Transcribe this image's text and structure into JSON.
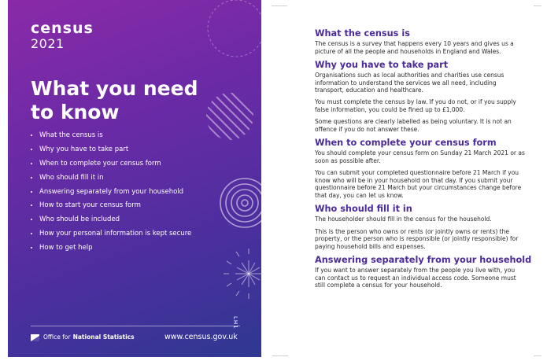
{
  "cover": {
    "brand": "census",
    "year": "2021",
    "title_line1": "What you need",
    "title_line2": "to know",
    "bullets": [
      "What the census is",
      "Why you have to take part",
      "When to complete your census form",
      "Who should fill it in",
      "Answering separately from your household",
      "How to start your census form",
      "Who should be included",
      "How your personal information is kept secure",
      "How to get help"
    ],
    "ons_prefix": "Office for",
    "ons_bold": "National Statistics",
    "url": "www.census.gov.uk",
    "code": "LH1",
    "colors": {
      "gradient_top": "#8a2aa8",
      "gradient_bottom": "#2f3892",
      "text": "#ffffff"
    }
  },
  "sections": {
    "s1": {
      "heading": "What the census is",
      "p1": "The census is a survey that happens every 10 years and gives us a picture of all the people and households in England and Wales."
    },
    "s2": {
      "heading": "Why you have to take part",
      "p1": "Organisations such as local authorities and charities use census information to understand the services we all need, including transport, education and healthcare.",
      "p2": "You must complete the census by law. If you do not, or if you supply false information, you could be fined up to £1,000.",
      "p3": "Some questions are clearly labelled as being voluntary. It is not an offence if you do not answer these."
    },
    "s3": {
      "heading": "When to complete your census form",
      "p1": "You should complete your census form on Sunday 21 March 2021 or as soon as possible after.",
      "p2": "You can submit your completed questionnaire before 21 March if you know who will be in your household on that day. If you submit your questionnaire before 21 March but your circumstances change before that day, you can let us know."
    },
    "s4": {
      "heading": "Who should fill it in",
      "p1": "The householder should fill in the census for the household.",
      "p2": "This is the person who owns or rents (or jointly owns or rents) the property, or the person who is responsible (or jointly responsible) for paying household bills and expenses."
    },
    "s5": {
      "heading": "Answering separately from your household",
      "p1": "If you want to answer separately from the people you live with, you can contact us to request an individual access code. Someone must still complete a census for your household."
    }
  },
  "colors": {
    "heading": "#4b2a9a",
    "body_text": "#2a2a2a",
    "page_bg": "#ffffff"
  }
}
